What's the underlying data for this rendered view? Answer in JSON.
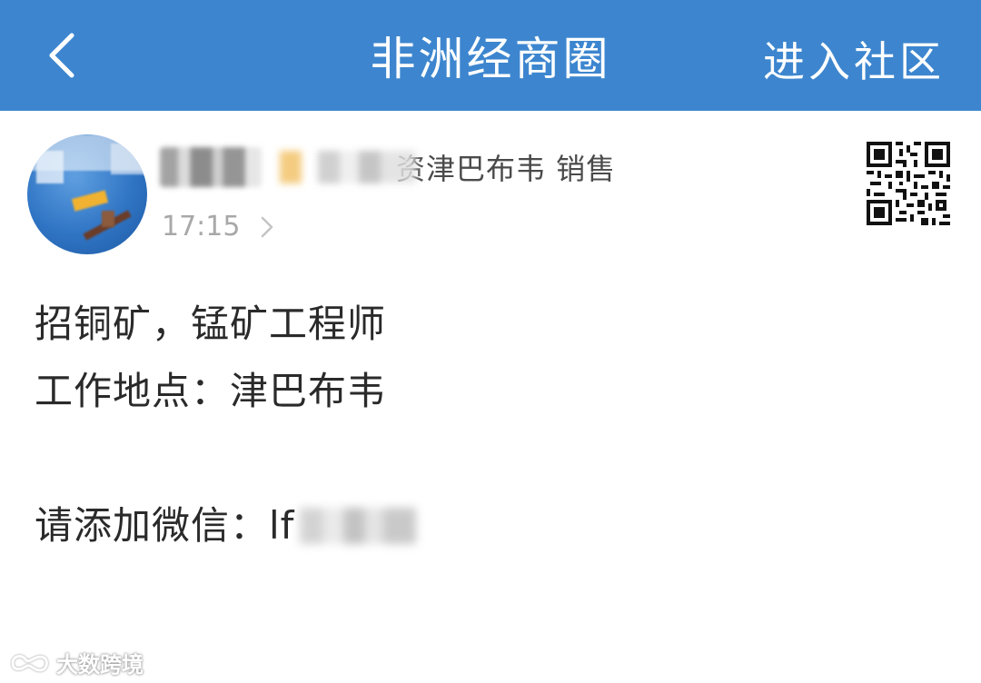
{
  "header": {
    "title": "非洲经商圈",
    "action_label": "进入社区",
    "back_icon": "chevron-left-icon",
    "background_color": "#3d86cf"
  },
  "post": {
    "author_tag_visible": "资津巴布韦 销售",
    "time": "17:15",
    "qr_icon": "qr-code-icon",
    "lines": [
      "招铜矿，锰矿工程师",
      "工作地点：津巴布韦"
    ],
    "wechat_label": "请添加微信：",
    "wechat_visible": "lf"
  },
  "watermark": {
    "text": "大数跨境"
  }
}
